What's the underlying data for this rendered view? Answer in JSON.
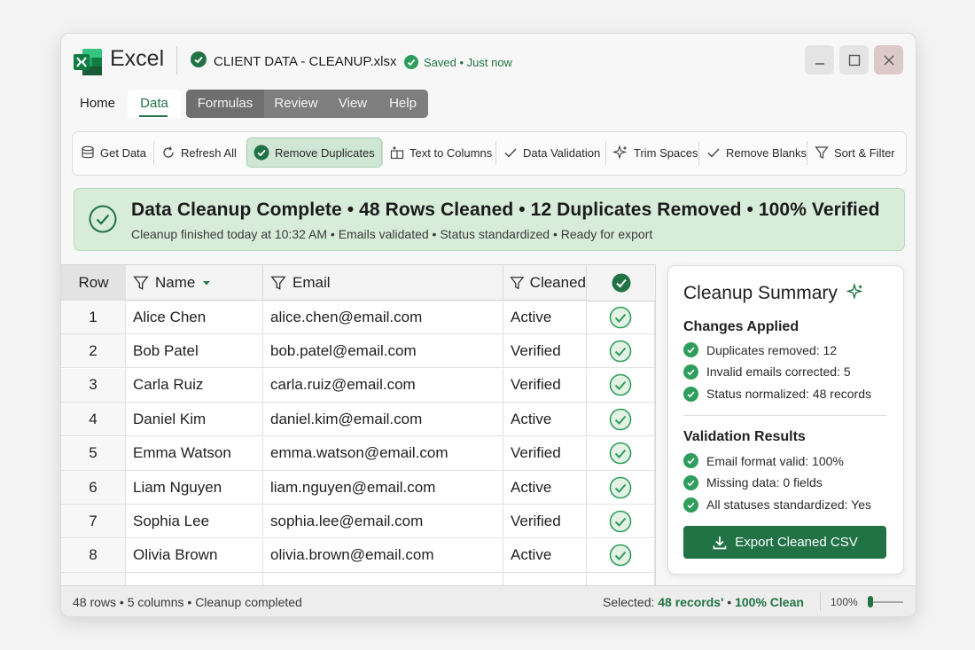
{
  "app": {
    "name": "Excel",
    "file_name": "CLIENT DATA - CLEANUP.xlsx",
    "save_status": "Saved • Just now"
  },
  "tabs": [
    {
      "label": "Home"
    },
    {
      "label": "Data"
    },
    {
      "label": "Formulas"
    },
    {
      "label": "Review"
    },
    {
      "label": "View"
    },
    {
      "label": "Help"
    }
  ],
  "ribbon": {
    "get_data": "Get Data",
    "refresh_all": "Refresh All",
    "remove_duplicates": "Remove Duplicates",
    "text_to_columns": "Text to Columns",
    "data_validation": "Data Validation",
    "trim_spaces": "Trim Spaces",
    "remove_blanks": "Remove Blanks",
    "sort_filter": "Sort & Filter"
  },
  "banner": {
    "title": "Data Cleanup Complete • 48 Rows Cleaned • 12 Duplicates Removed • 100% Verified",
    "subtitle": "Cleanup finished today at 10:32 AM • Emails validated • Status standardized • Ready for export"
  },
  "table": {
    "headers": {
      "row": "Row",
      "name": "Name",
      "email": "Email",
      "cleaned": "Cleaned"
    },
    "rows": [
      {
        "n": "1",
        "name": "Alice Chen",
        "email": "alice.chen@email.com",
        "status": "Active"
      },
      {
        "n": "2",
        "name": "Bob Patel",
        "email": "bob.patel@email.com",
        "status": "Verified"
      },
      {
        "n": "3",
        "name": "Carla Ruiz",
        "email": "carla.ruiz@email.com",
        "status": "Verified"
      },
      {
        "n": "4",
        "name": "Daniel Kim",
        "email": "daniel.kim@email.com",
        "status": "Active"
      },
      {
        "n": "5",
        "name": "Emma Watson",
        "email": "emma.watson@email.com",
        "status": "Verified"
      },
      {
        "n": "6",
        "name": "Liam Nguyen",
        "email": "liam.nguyen@email.com",
        "status": "Active"
      },
      {
        "n": "7",
        "name": "Sophia Lee",
        "email": "sophia.lee@email.com",
        "status": "Verified"
      },
      {
        "n": "8",
        "name": "Olivia Brown",
        "email": "olivia.brown@email.com",
        "status": "Active"
      }
    ]
  },
  "summary": {
    "title": "Cleanup Summary",
    "changes_heading": "Changes Applied",
    "changes": [
      "Duplicates removed: 12",
      "Invalid emails corrected: 5",
      "Status normalized: 48 records"
    ],
    "validation_heading": "Validation Results",
    "validation": [
      "Email format valid: 100%",
      "Missing data: 0 fields",
      "All statuses standardized: Yes"
    ],
    "export_label": "Export Cleaned CSV"
  },
  "status": {
    "left": "48 rows • 5 columns • Cleanup completed",
    "selected_prefix": "Selected: ",
    "selected_value": "48 records'",
    "separator": " • ",
    "clean_value": "100% Clean",
    "zoom": "100%"
  },
  "colors": {
    "accent": "#217346",
    "banner_bg": "#d7ecd9",
    "check": "#2f9d5c"
  }
}
